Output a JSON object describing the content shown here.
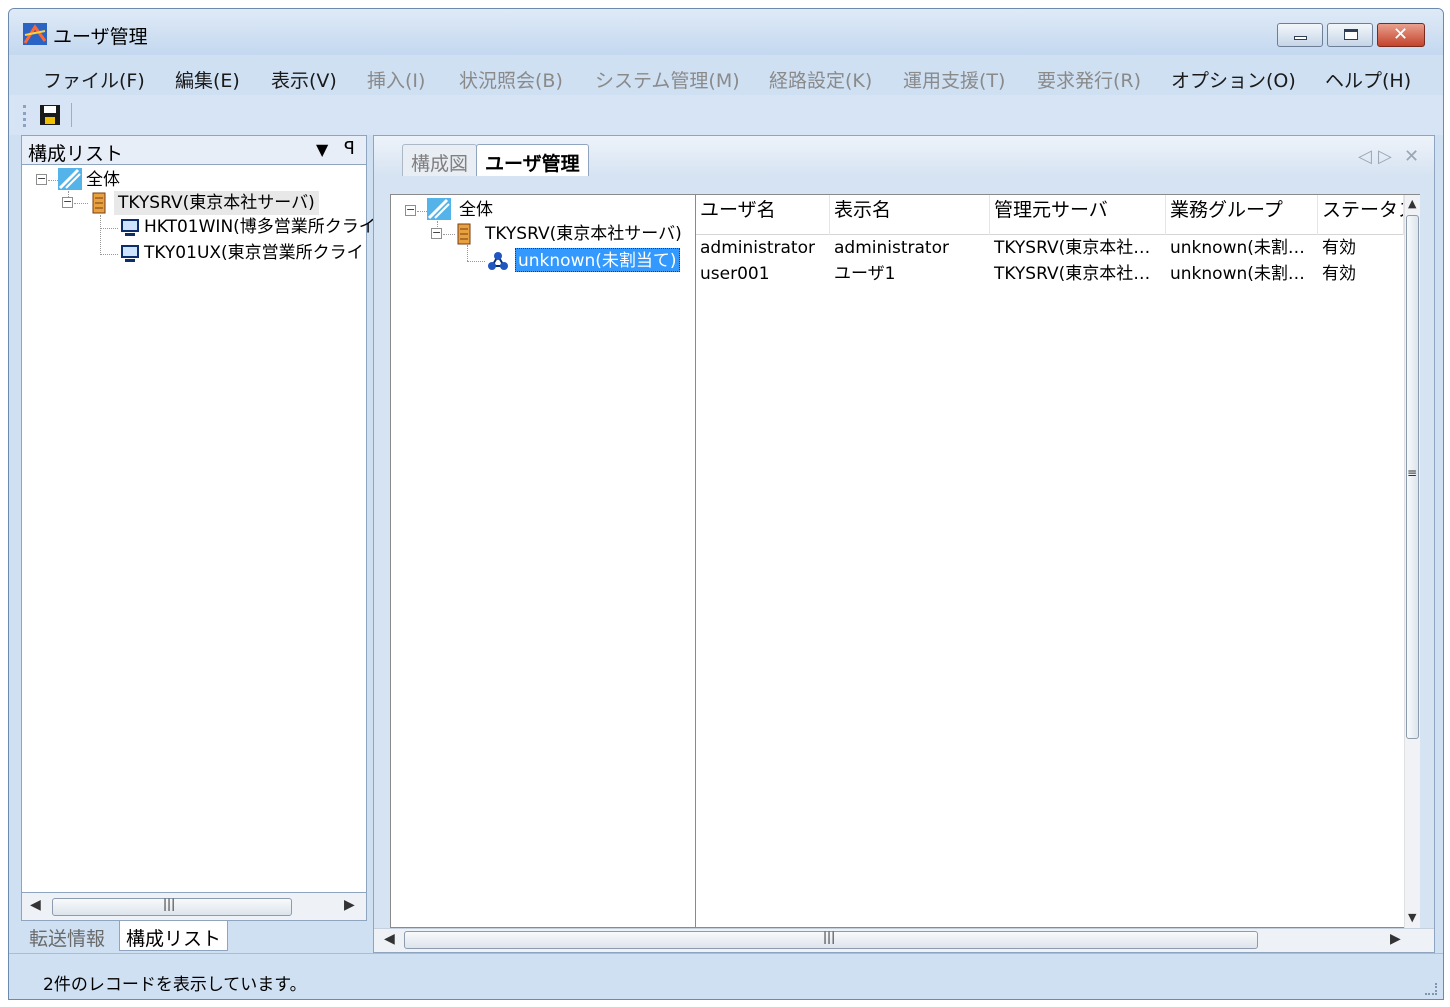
{
  "window": {
    "title": "ユーザ管理",
    "buttons": {
      "minimize": "minimize",
      "maximize": "maximize",
      "close": "x"
    }
  },
  "menu": [
    {
      "label": "ファイル(F)",
      "enabled": true
    },
    {
      "label": "編集(E)",
      "enabled": true
    },
    {
      "label": "表示(V)",
      "enabled": true
    },
    {
      "label": "挿入(I)",
      "enabled": false
    },
    {
      "label": "状況照会(B)",
      "enabled": false
    },
    {
      "label": "システム管理(M)",
      "enabled": false
    },
    {
      "label": "経路設定(K)",
      "enabled": false
    },
    {
      "label": "運用支援(T)",
      "enabled": false
    },
    {
      "label": "要求発行(R)",
      "enabled": false
    },
    {
      "label": "オプション(O)",
      "enabled": true
    },
    {
      "label": "ヘルプ(H)",
      "enabled": true
    }
  ],
  "toolbar": {
    "save_icon": "save-icon"
  },
  "left_panel": {
    "title": "構成リスト",
    "dropdown_glyph": "▼",
    "pin_glyph": "ꟼ",
    "tree": {
      "root": "全体",
      "server": "TKYSRV(東京本社サーバ)",
      "clients": [
        "HKT01WIN(博多営業所クライ",
        "TKY01UX(東京営業所クライ"
      ]
    },
    "tabs": {
      "inactive": "転送情報",
      "active": "構成リスト"
    }
  },
  "right_panel": {
    "tabs": {
      "inactive": "構成図",
      "active": "ユーザ管理"
    },
    "tree": {
      "root": "全体",
      "server": "TKYSRV(東京本社サーバ)",
      "group": "unknown(未割当て)"
    },
    "list": {
      "columns": [
        "ユーザ名",
        "表示名",
        "管理元サーバ",
        "業務グループ",
        "ステータス"
      ],
      "rows": [
        [
          "administrator",
          "administrator",
          "TKYSRV(東京本社…",
          "unknown(未割当…",
          "有効"
        ],
        [
          "user001",
          "ユーザ1",
          "TKYSRV(東京本社…",
          "unknown(未割当…",
          "有効"
        ]
      ]
    }
  },
  "status": {
    "text": "2件のレコードを表示しています。"
  }
}
